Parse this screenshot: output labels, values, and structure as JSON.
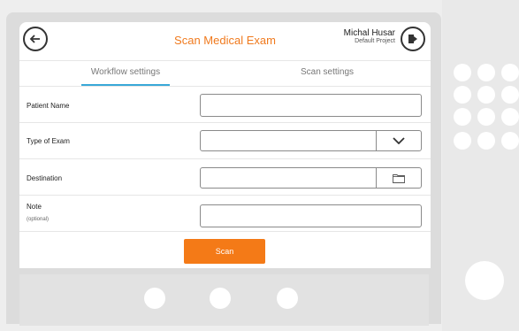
{
  "header": {
    "title": "Scan Medical Exam",
    "user_name": "Michal Husar",
    "project": "Default Project"
  },
  "tabs": [
    {
      "label": "Workflow settings",
      "active": true
    },
    {
      "label": "Scan settings",
      "active": false
    }
  ],
  "form": {
    "patient_name": {
      "label": "Patient Name",
      "value": ""
    },
    "type_of_exam": {
      "label": "Type of Exam",
      "value": ""
    },
    "destination": {
      "label": "Destination",
      "value": ""
    },
    "note": {
      "label": "Note",
      "sublabel": "(optional)",
      "value": ""
    }
  },
  "actions": {
    "scan_label": "Scan"
  },
  "colors": {
    "accent": "#f07a1e",
    "tab_indicator": "#39a8d8"
  }
}
